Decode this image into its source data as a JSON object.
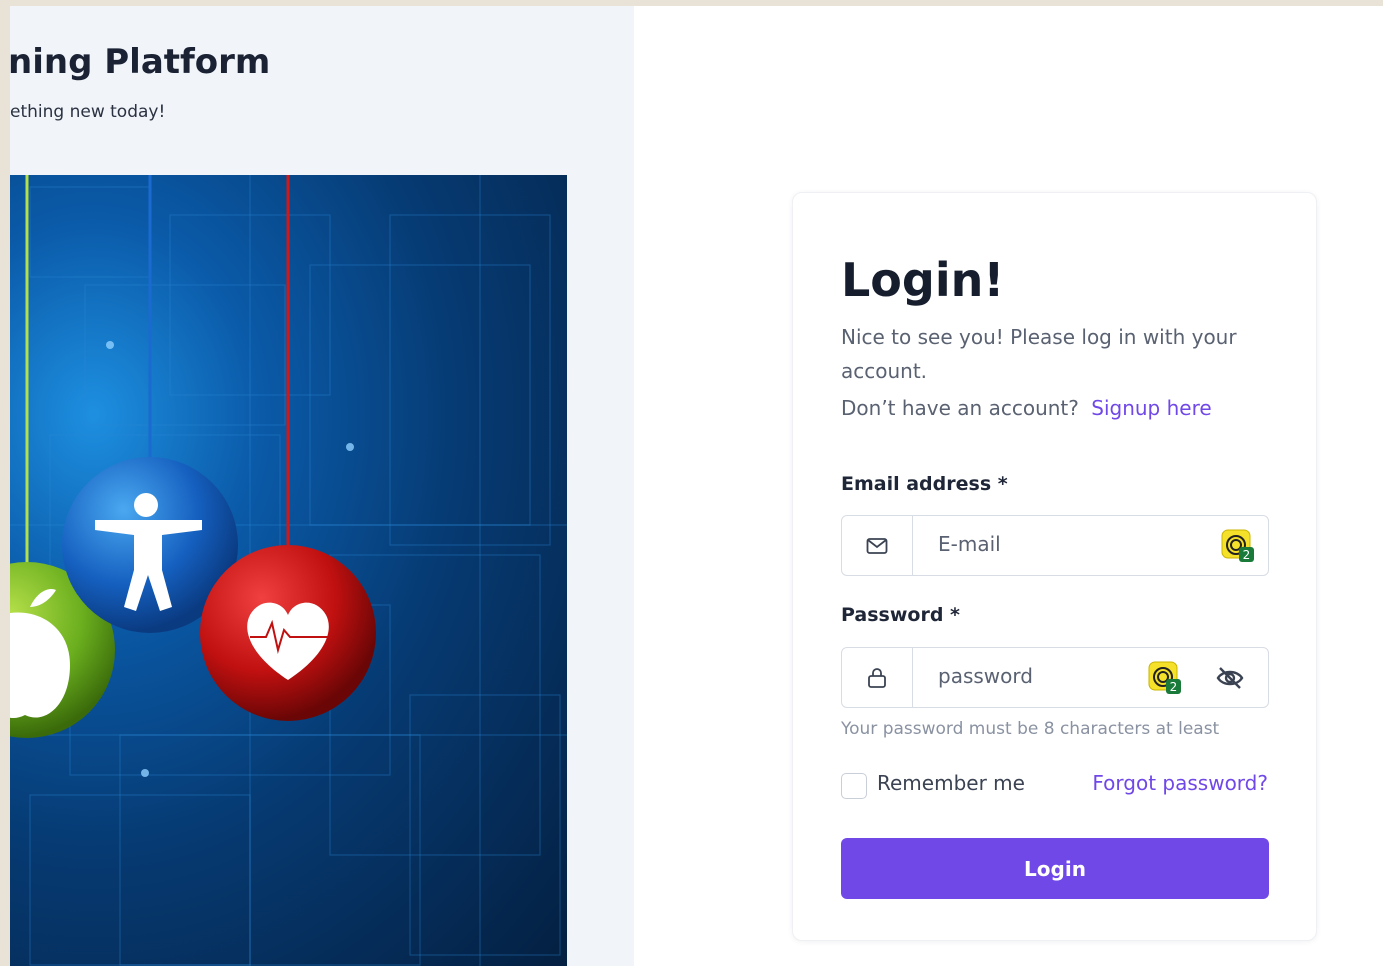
{
  "hero": {
    "title": "ning Platform",
    "subtitle": "ething new today!"
  },
  "login": {
    "title": "Login!",
    "description": "Nice to see you! Please log in with your account.",
    "no_account_text": "Don’t have an account?",
    "signup_link": "Signup here",
    "email_label": "Email address *",
    "email_placeholder": "E-mail",
    "password_label": "Password *",
    "password_placeholder": "password",
    "password_hint": "Your password must be 8 characters at least",
    "remember_label": "Remember me",
    "forgot_link": "Forgot password?",
    "submit_label": "Login",
    "extension_badge_count": "2"
  },
  "colors": {
    "accent": "#7048e8",
    "left_panel_bg": "#f1f4f8"
  },
  "icons": [
    "mail-icon",
    "lock-icon",
    "password-manager-icon",
    "eye-off-icon"
  ]
}
